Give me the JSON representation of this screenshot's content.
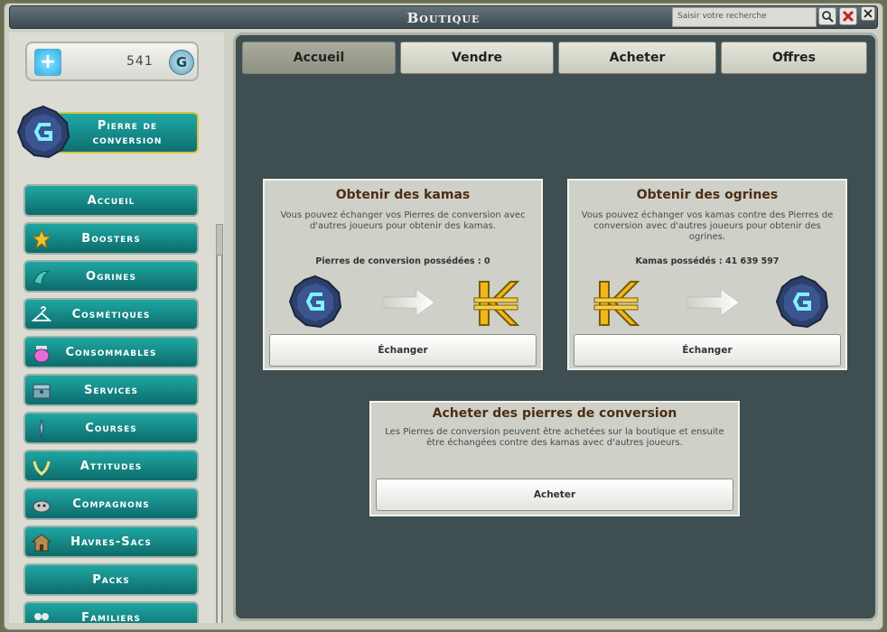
{
  "window": {
    "title": "Boutique"
  },
  "search": {
    "placeholder": "Saisir votre recherche"
  },
  "balance": {
    "value": "541"
  },
  "conversion_button": {
    "line1": "Pierre de",
    "line2": "conversion"
  },
  "sidebar": {
    "items": [
      {
        "label": "Accueil",
        "icon": "none"
      },
      {
        "label": "Boosters",
        "icon": "star-icon"
      },
      {
        "label": "Ogrines",
        "icon": "ogrine-icon"
      },
      {
        "label": "Cosmétiques",
        "icon": "hanger-icon"
      },
      {
        "label": "Consommables",
        "icon": "potion-icon"
      },
      {
        "label": "Services",
        "icon": "chest-icon"
      },
      {
        "label": "Courses",
        "icon": "mount-icon"
      },
      {
        "label": "Attitudes",
        "icon": "emote-icon"
      },
      {
        "label": "Compagnons",
        "icon": "companion-icon"
      },
      {
        "label": "Havres-Sacs",
        "icon": "house-icon"
      },
      {
        "label": "Packs",
        "icon": "none"
      },
      {
        "label": "Familiers",
        "icon": "pet-icon"
      }
    ]
  },
  "tabs": [
    {
      "label": "Accueil",
      "active": true
    },
    {
      "label": "Vendre",
      "active": false
    },
    {
      "label": "Acheter",
      "active": false
    },
    {
      "label": "Offres",
      "active": false
    }
  ],
  "cards": {
    "kamas": {
      "title": "Obtenir des kamas",
      "desc": "Vous pouvez échanger vos Pierres de conversion avec d'autres joueurs pour obtenir des kamas.",
      "count": "Pierres de conversion possédées : 0",
      "button": "Échanger"
    },
    "ogrines": {
      "title": "Obtenir des ogrines",
      "desc": "Vous pouvez échanger vos kamas contre des Pierres de conversion avec d'autres joueurs pour obtenir des ogrines.",
      "count": "Kamas possédés : 41 639 597",
      "button": "Échanger"
    },
    "buy": {
      "title": "Acheter des pierres de conversion",
      "desc": "Les Pierres de conversion peuvent être achetées sur la boutique et ensuite être échangées contre des kamas avec d'autres joueurs.",
      "button": "Acheter"
    }
  },
  "colors": {
    "accent_teal": "#13928f",
    "panel_dark": "#3f4e50",
    "gold": "#e8b21c"
  }
}
